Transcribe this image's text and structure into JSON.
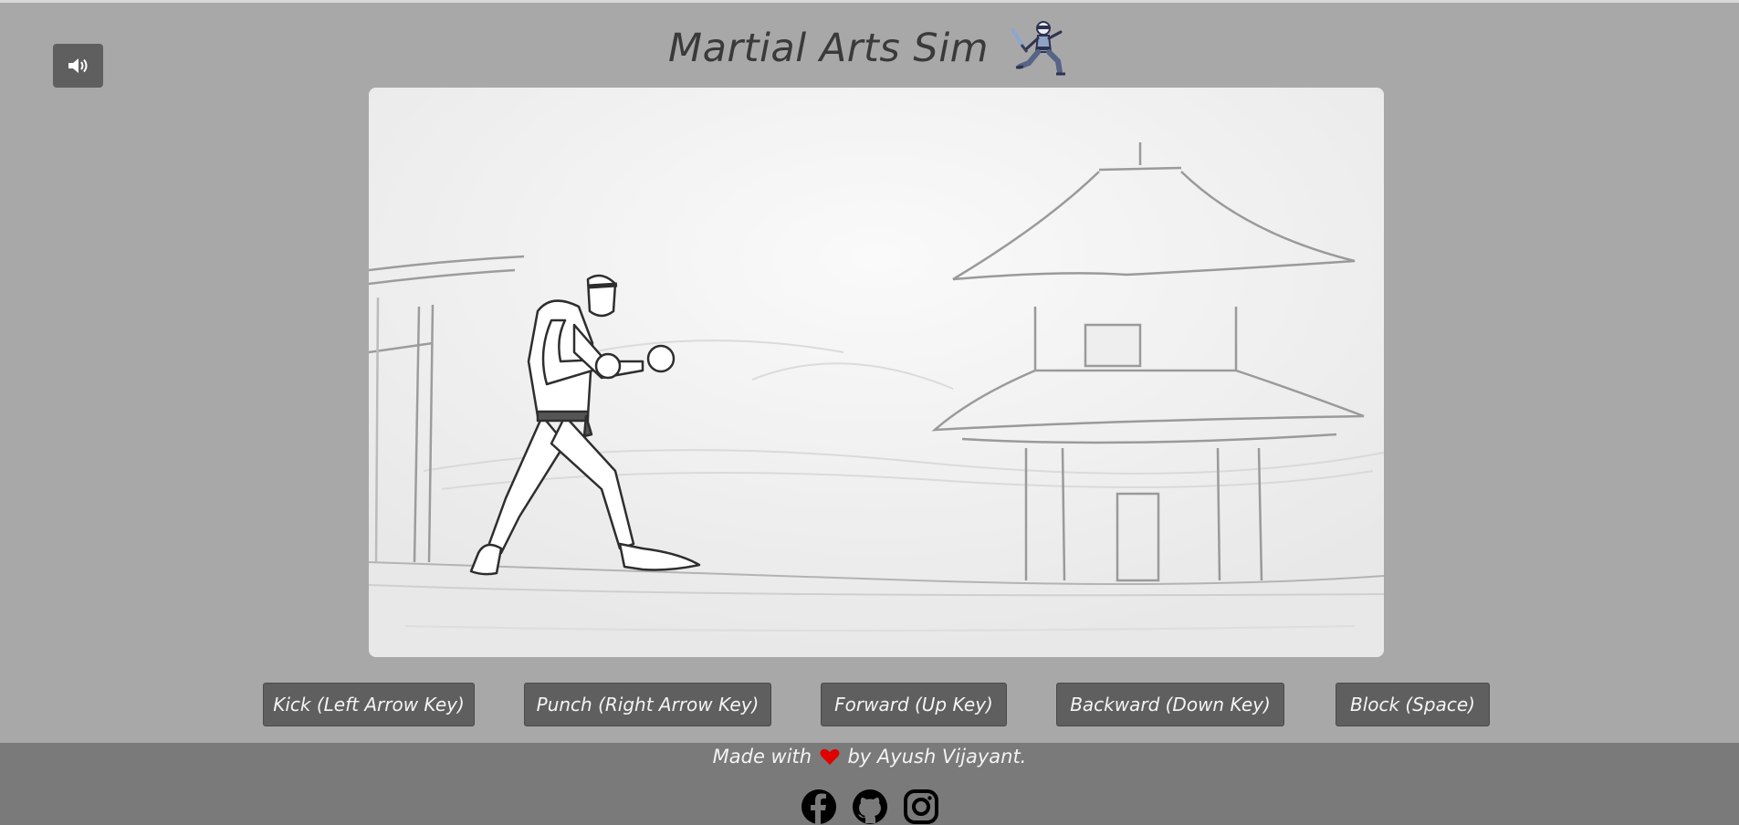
{
  "header": {
    "title": "Martial Arts Sim",
    "sound_icon": "speaker-volume-icon",
    "logo_icon": "ninja-sword-logo"
  },
  "game": {
    "scene": "sketch-dojo-pagoda-background",
    "player": "karate-fighter"
  },
  "controls": [
    {
      "label": "Kick (Left Arrow Key)"
    },
    {
      "label": "Punch (Right Arrow Key)"
    },
    {
      "label": "Forward (Up Key)"
    },
    {
      "label": "Backward (Down Key)"
    },
    {
      "label": "Block (Space)"
    }
  ],
  "footer": {
    "made_with": "Made with",
    "by_text": "by Ayush Vijayant.",
    "heart_icon": "heart-icon",
    "socials": [
      {
        "icon": "facebook-icon"
      },
      {
        "icon": "github-icon"
      },
      {
        "icon": "instagram-icon"
      }
    ]
  },
  "colors": {
    "page_bg": "#a9a8a9",
    "button_bg": "#5f5f5f",
    "footer_bg": "#7a7a7a",
    "heart": "#e00000"
  }
}
